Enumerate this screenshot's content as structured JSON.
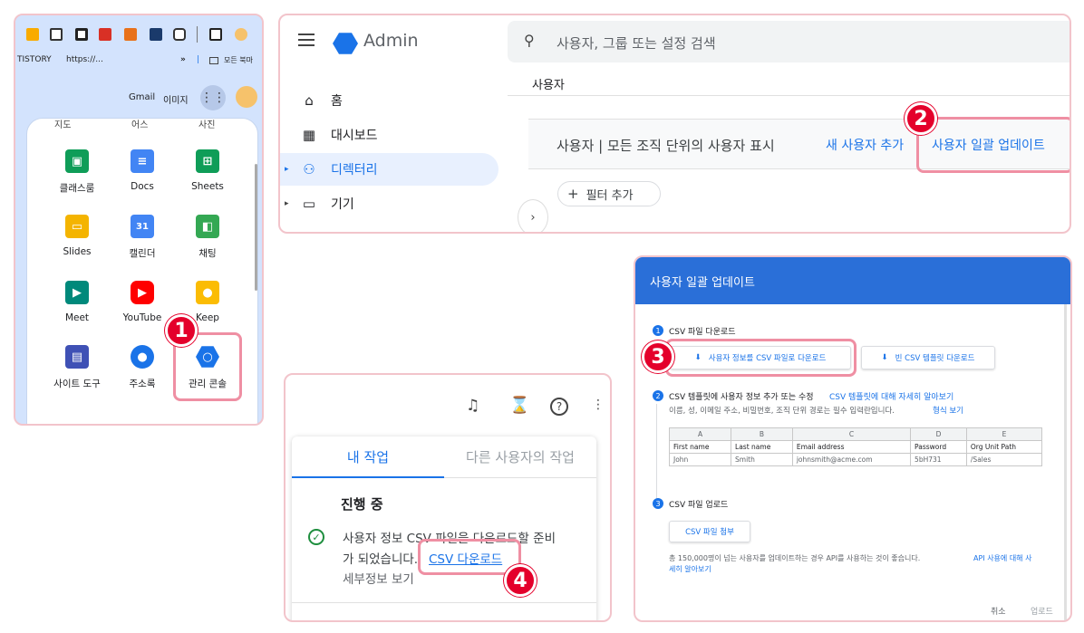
{
  "colors": {
    "accent": "#1a73e8",
    "highlight": "#ef8fa3",
    "badge": "#e4002b",
    "header_blue": "#2a6fd8"
  },
  "badges": [
    "1",
    "2",
    "3",
    "4"
  ],
  "p1": {
    "bookmarks": [
      "TISTORY",
      "https://...",
      "»",
      "모든 북마"
    ],
    "top_links": [
      "Gmail",
      "이미지"
    ],
    "cut_labels": [
      "지도",
      "어스",
      "사진"
    ],
    "apps": [
      {
        "label": "클래스룸",
        "icon": "classroom-icon",
        "color": "#0f9d58"
      },
      {
        "label": "Docs",
        "icon": "docs-icon",
        "color": "#4285f4"
      },
      {
        "label": "Sheets",
        "icon": "sheets-icon",
        "color": "#0f9d58"
      },
      {
        "label": "Slides",
        "icon": "slides-icon",
        "color": "#f4b400"
      },
      {
        "label": "캘린더",
        "icon": "calendar-icon",
        "color": "#4285f4"
      },
      {
        "label": "채팅",
        "icon": "chat-icon",
        "color": "#34a853"
      },
      {
        "label": "Meet",
        "icon": "meet-icon",
        "color": "#00897b"
      },
      {
        "label": "YouTube",
        "icon": "youtube-icon",
        "color": "#ff0000"
      },
      {
        "label": "Keep",
        "icon": "keep-icon",
        "color": "#fbbc04"
      },
      {
        "label": "사이트 도구",
        "icon": "sites-icon",
        "color": "#3f51b5"
      },
      {
        "label": "주소록",
        "icon": "contacts-icon",
        "color": "#1a73e8"
      },
      {
        "label": "관리 콘솔",
        "icon": "admin-icon",
        "color": "#1a73e8"
      }
    ]
  },
  "p2": {
    "brand": "Admin",
    "search_placeholder": "사용자, 그룹 또는 설정 검색",
    "breadcrumb": "사용자",
    "nav": [
      {
        "label": "홈",
        "icon": "home-icon"
      },
      {
        "label": "대시보드",
        "icon": "dashboard-icon"
      },
      {
        "label": "디렉터리",
        "icon": "person-icon"
      },
      {
        "label": "기기",
        "icon": "devices-icon"
      }
    ],
    "card_title": "사용자 | 모든 조직 단위의 사용자 표시",
    "add_user": "새 사용자 추가",
    "bulk_update": "사용자 일괄 업데이트",
    "filter": "필터 추가"
  },
  "p3": {
    "tab_mine": "내 작업",
    "tab_others": "다른 사용자의 작업",
    "section": "진행 중",
    "message_line1": "사용자 정보 CSV 파일을 다운로드할 준비",
    "message_line2_prefix": "가 되었습니다.",
    "download_link": "CSV 다운로드",
    "details": "세부정보 보기"
  },
  "p4": {
    "title": "사용자 일괄 업데이트",
    "step1": "CSV 파일 다운로드",
    "btn_download_info": "사용자 정보를 CSV 파일로 다운로드",
    "btn_blank_template": "빈 CSV 템플릿 다운로드",
    "step2_prefix": "CSV 템플릿에 사용자 정보 추가 또는 수정",
    "step2_link": "CSV 템플릿에 대해 자세히 알아보기",
    "step2_desc": "이름, 성, 이메일 주소, 비밀번호, 조직 단위 경로는 필수 입력란입니다.",
    "step2_desc_link": "형식 보기",
    "table": {
      "letters": [
        "A",
        "B",
        "C",
        "D",
        "E"
      ],
      "headers": [
        "First name",
        "Last name",
        "Email address",
        "Password",
        "Org Unit Path"
      ],
      "row": [
        "John",
        "Smith",
        "johnsmith@acme.com",
        "5bH731",
        "/Sales"
      ]
    },
    "step3": "CSV 파일 업로드",
    "btn_attach": "CSV 파일 첨부",
    "note": "총 150,000명이 넘는 사용자를 업데이트하는 경우 API를 사용하는 것이 좋습니다.",
    "note_link_1": "API 사용에 대해 사",
    "note_link_2": "세히 알아보기",
    "cancel": "취소",
    "upload": "업로드"
  }
}
